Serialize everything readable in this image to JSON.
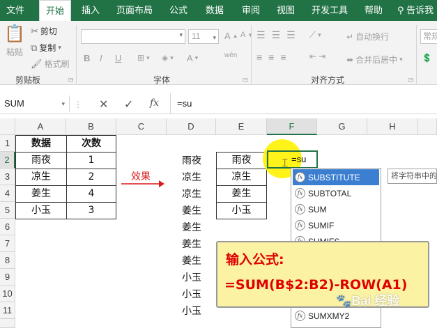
{
  "ribbon": {
    "tabs": [
      "文件",
      "开始",
      "插入",
      "页面布局",
      "公式",
      "数据",
      "审阅",
      "视图",
      "开发工具",
      "帮助"
    ],
    "active_tab": "开始",
    "tell_me": "告诉我",
    "clipboard": {
      "paste": "粘贴",
      "cut": "剪切",
      "copy": "复制",
      "format_painter": "格式刷",
      "group_label": "剪贴板"
    },
    "font": {
      "name": "",
      "size": "11",
      "bold": "B",
      "italic": "I",
      "underline": "U",
      "phonetic": "wén",
      "grow": "A",
      "shrink": "A",
      "color_a": "A",
      "group_label": "字体"
    },
    "alignment": {
      "wrap": "自动换行",
      "merge": "合并后居中",
      "group_label": "对齐方式"
    },
    "number": {
      "format": "常规"
    }
  },
  "formula_bar": {
    "name_box": "SUM",
    "cancel": "✕",
    "enter": "✓",
    "fx": "fx",
    "content": "=su"
  },
  "grid": {
    "columns": [
      "A",
      "B",
      "C",
      "D",
      "E",
      "F",
      "G",
      "H"
    ],
    "rows": [
      "1",
      "2",
      "3",
      "4",
      "5",
      "6",
      "7",
      "8",
      "9",
      "10",
      "11"
    ],
    "table1_headers": [
      "数据",
      "次数"
    ],
    "table1_rows": [
      [
        "雨夜",
        "1"
      ],
      [
        "凉生",
        "2"
      ],
      [
        "姜生",
        "4"
      ],
      [
        "小玉",
        "3"
      ]
    ],
    "arrow_label": "效果",
    "col_d": [
      "雨夜",
      "凉生",
      "凉生",
      "姜生",
      "姜生",
      "姜生",
      "姜生",
      "小玉",
      "小玉",
      "小玉"
    ],
    "col_e": [
      "雨夜",
      "凉生",
      "姜生",
      "小玉"
    ],
    "active_cell_text": "=su"
  },
  "autocomplete": {
    "items": [
      "SUBSTITUTE",
      "SUBTOTAL",
      "SUM",
      "SUMIF",
      "SUMIFS",
      "SUMXMY2"
    ],
    "selected": "SUBSTITUTE",
    "tooltip": "将字符串中的"
  },
  "callout": {
    "line1": "输入公式:",
    "line2": "=SUM(B$2:B2)-ROW(A1)"
  },
  "watermark": "Bai 经验",
  "colors": {
    "accent": "#217346",
    "selection": "#3c7fd1",
    "callout_bg": "#fbf3a3",
    "callout_text": "#e00000",
    "arrow": "#d91c1c"
  }
}
